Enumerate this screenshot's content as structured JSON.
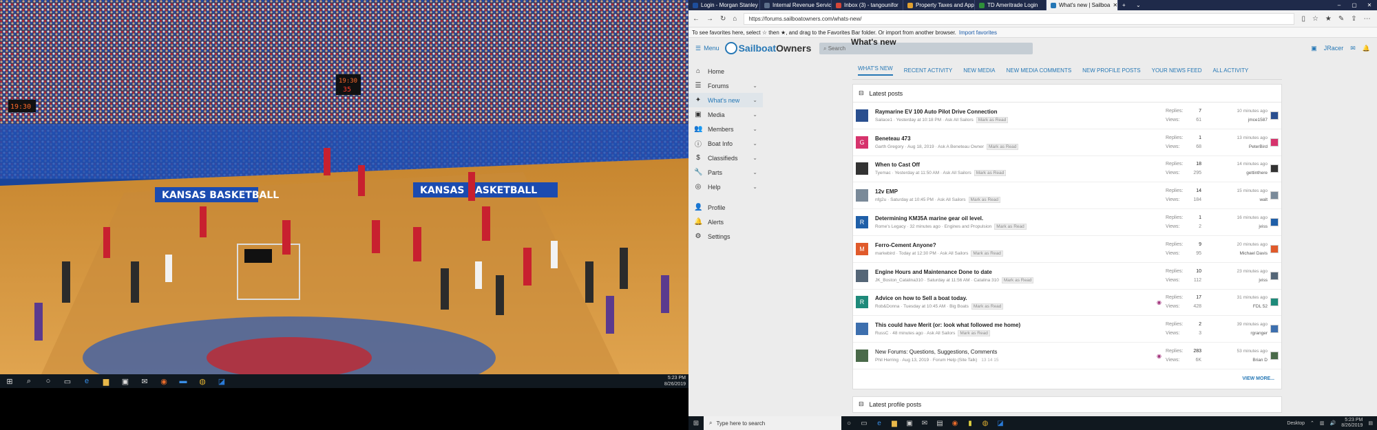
{
  "left": {
    "clock_time": "5:23 PM",
    "clock_date": "8/26/2019",
    "scoreboard": [
      "19:30",
      "35",
      "19:30"
    ],
    "banner_text": [
      "KANSAS BASKETBALL",
      "KANSAS BASKETBALL"
    ]
  },
  "browser": {
    "tabs": [
      {
        "label": "Login - Morgan Stanley",
        "color": "#1e4e9c"
      },
      {
        "label": "Internal Revenue Servic",
        "color": "#5c6f8a"
      },
      {
        "label": "Inbox (3) - tangounifor",
        "color": "#d44638"
      },
      {
        "label": "Property Taxes and App",
        "color": "#e0a030"
      },
      {
        "label": "TD Ameritrade Login",
        "color": "#2f8f3a"
      },
      {
        "label": "What's new | Sailboa",
        "color": "#2577b5"
      }
    ],
    "url": "https://forums.sailboatowners.com/whats-new/",
    "favbar_text": "To see favorites here, select ☆ then ★, and drag to the Favorites Bar folder. Or import from another browser.",
    "favbar_link": "Import favorites"
  },
  "site": {
    "menu_label": "Menu",
    "brand_a": "Sailboat",
    "brand_b": "Owners",
    "search_placeholder": "Search",
    "page_title": "What's new",
    "user": "JRacer",
    "sidebar": [
      {
        "label": "Home",
        "icon": "⌂",
        "chev": ""
      },
      {
        "label": "Forums",
        "icon": "☰",
        "chev": "⌄"
      },
      {
        "label": "What's new",
        "icon": "✦",
        "chev": "⌄"
      },
      {
        "label": "Media",
        "icon": "▣",
        "chev": "⌄"
      },
      {
        "label": "Members",
        "icon": "👥",
        "chev": "⌄"
      },
      {
        "label": "Boat Info",
        "icon": "ⓘ",
        "chev": "⌄"
      },
      {
        "label": "Classifieds",
        "icon": "$",
        "chev": "⌄"
      },
      {
        "label": "Parts",
        "icon": "🔧",
        "chev": "⌄"
      },
      {
        "label": "Help",
        "icon": "◎",
        "chev": "⌄"
      },
      {
        "label": "Profile",
        "icon": "👤",
        "chev": ""
      },
      {
        "label": "Alerts",
        "icon": "🔔",
        "chev": ""
      },
      {
        "label": "Settings",
        "icon": "⚙",
        "chev": ""
      }
    ],
    "nav_tabs": [
      "What's new",
      "Recent activity",
      "New media",
      "New media comments",
      "New profile posts",
      "Your news feed",
      "All activity"
    ],
    "latest_posts_title": "Latest posts",
    "replies_label": "Replies:",
    "views_label": "Views:",
    "mark_read": "Mark as Read",
    "posts": [
      {
        "title": "Raymarine EV 100 Auto Pilot Drive Connection",
        "author": "Sailace1",
        "date": "Yesterday at 10:18 PM",
        "forum": "Ask All Sailors",
        "replies": "7",
        "views": "61",
        "ago": "10 minutes ago",
        "last_user": "jmce1587",
        "avatar_color": "#2a4f8f",
        "avatar_letter": "",
        "bold": true
      },
      {
        "title": "Beneteau 473",
        "author": "Garth Gregory",
        "date": "Aug 18, 2019",
        "forum": "Ask A Beneteau Owner",
        "replies": "1",
        "views": "68",
        "ago": "13 minutes ago",
        "last_user": "PeterBird",
        "avatar_color": "#d6336c",
        "avatar_letter": "G",
        "bold": true
      },
      {
        "title": "When to Cast Off",
        "author": "Tyemac",
        "date": "Yesterday at 11:50 AM",
        "forum": "Ask All Sailors",
        "replies": "18",
        "views": "295",
        "ago": "14 minutes ago",
        "last_user": "gettinthere",
        "avatar_color": "#333333",
        "avatar_letter": "",
        "bold": true
      },
      {
        "title": "12v EMP",
        "author": "nfg2u",
        "date": "Saturday at 10:45 PM",
        "forum": "Ask All Sailors",
        "replies": "14",
        "views": "184",
        "ago": "15 minutes ago",
        "last_user": "walt",
        "avatar_color": "#7a8a99",
        "avatar_letter": "",
        "bold": true
      },
      {
        "title": "Determining KM35A marine gear oil level.",
        "author": "Rome's Legacy",
        "date": "32 minutes ago",
        "forum": "Engines and Propulsion",
        "replies": "1",
        "views": "2",
        "ago": "16 minutes ago",
        "last_user": "jviss",
        "avatar_color": "#1f5fa8",
        "avatar_letter": "R",
        "bold": true
      },
      {
        "title": "Ferro-Cement Anyone?",
        "author": "markebird",
        "date": "Today at 12:30 PM",
        "forum": "Ask All Sailors",
        "replies": "9",
        "views": "95",
        "ago": "20 minutes ago",
        "last_user": "Michael Davis",
        "avatar_color": "#e05a2b",
        "avatar_letter": "M",
        "bold": true
      },
      {
        "title": "Engine Hours and Maintenance Done to date",
        "author": "JK_Boston_Catalina310",
        "date": "Saturday at 11:56 AM",
        "forum": "Catalina 310",
        "replies": "10",
        "views": "112",
        "ago": "23 minutes ago",
        "last_user": "jviss",
        "avatar_color": "#556677",
        "avatar_letter": "",
        "bold": true
      },
      {
        "title": "Advice on how to Sell a boat today.",
        "author": "Rob&Donna",
        "date": "Tuesday at 10:45 AM",
        "forum": "Big Boats",
        "replies": "17",
        "views": "428",
        "ago": "31 minutes ago",
        "last_user": "FDL 52",
        "avatar_color": "#1e8a7a",
        "avatar_letter": "R",
        "bold": true
      },
      {
        "title": "This could have Merit (or: look what followed me home)",
        "author": "RussC",
        "date": "48 minutes ago",
        "forum": "Ask All Sailors",
        "replies": "2",
        "views": "3",
        "ago": "39 minutes ago",
        "last_user": "rgranger",
        "avatar_color": "#3d6fae",
        "avatar_letter": "",
        "bold": true
      },
      {
        "title": "New Forums: Questions, Suggestions, Comments",
        "author": "Phil Herring",
        "date": "Aug 13, 2019",
        "forum": "Forum Help (Site Talk)",
        "replies": "283",
        "views": "6K",
        "ago": "53 minutes ago",
        "last_user": "Brian D",
        "avatar_color": "#4a6a4a",
        "avatar_letter": "",
        "bold": false,
        "pages": "13  14  15"
      }
    ],
    "view_more": "VIEW MORE...",
    "latest_profile_posts": "Latest profile posts"
  },
  "taskbar": {
    "search_placeholder": "Type here to search",
    "desktop_label": "Desktop",
    "time": "5:23 PM",
    "date": "8/26/2019"
  }
}
